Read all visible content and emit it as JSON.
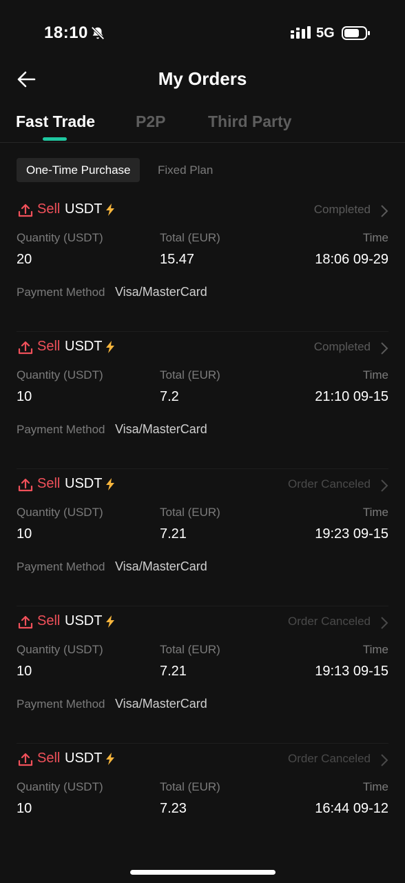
{
  "status_bar": {
    "time": "18:10",
    "network": "5G"
  },
  "header": {
    "title": "My Orders"
  },
  "tabs": [
    {
      "label": "Fast Trade",
      "active": true
    },
    {
      "label": "P2P",
      "active": false
    },
    {
      "label": "Third Party",
      "active": false
    }
  ],
  "subtabs": [
    {
      "label": "One-Time Purchase",
      "active": true
    },
    {
      "label": "Fixed Plan",
      "active": false
    }
  ],
  "labels": {
    "quantity": "Quantity (USDT)",
    "total": "Total (EUR)",
    "time": "Time",
    "payment_method": "Payment Method"
  },
  "orders": [
    {
      "side": "Sell",
      "coin": "USDT",
      "status": "Completed",
      "quantity": "20",
      "total": "15.47",
      "time": "18:06 09-29",
      "payment_method": "Visa/MasterCard"
    },
    {
      "side": "Sell",
      "coin": "USDT",
      "status": "Completed",
      "quantity": "10",
      "total": "7.2",
      "time": "21:10 09-15",
      "payment_method": "Visa/MasterCard"
    },
    {
      "side": "Sell",
      "coin": "USDT",
      "status": "Order Canceled",
      "quantity": "10",
      "total": "7.21",
      "time": "19:23 09-15",
      "payment_method": "Visa/MasterCard"
    },
    {
      "side": "Sell",
      "coin": "USDT",
      "status": "Order Canceled",
      "quantity": "10",
      "total": "7.21",
      "time": "19:13 09-15",
      "payment_method": "Visa/MasterCard"
    },
    {
      "side": "Sell",
      "coin": "USDT",
      "status": "Order Canceled",
      "quantity": "10",
      "total": "7.23",
      "time": "16:44 09-12",
      "payment_method": ""
    }
  ],
  "colors": {
    "sell": "#f0505a",
    "accent": "#1fc7a0",
    "bolt": "#f5b43c",
    "background": "#121212"
  },
  "icons": [
    "back-arrow-icon",
    "bell-muted-icon",
    "signal-icon",
    "battery-icon",
    "upload-icon",
    "lightning-icon",
    "chevron-right-icon"
  ]
}
